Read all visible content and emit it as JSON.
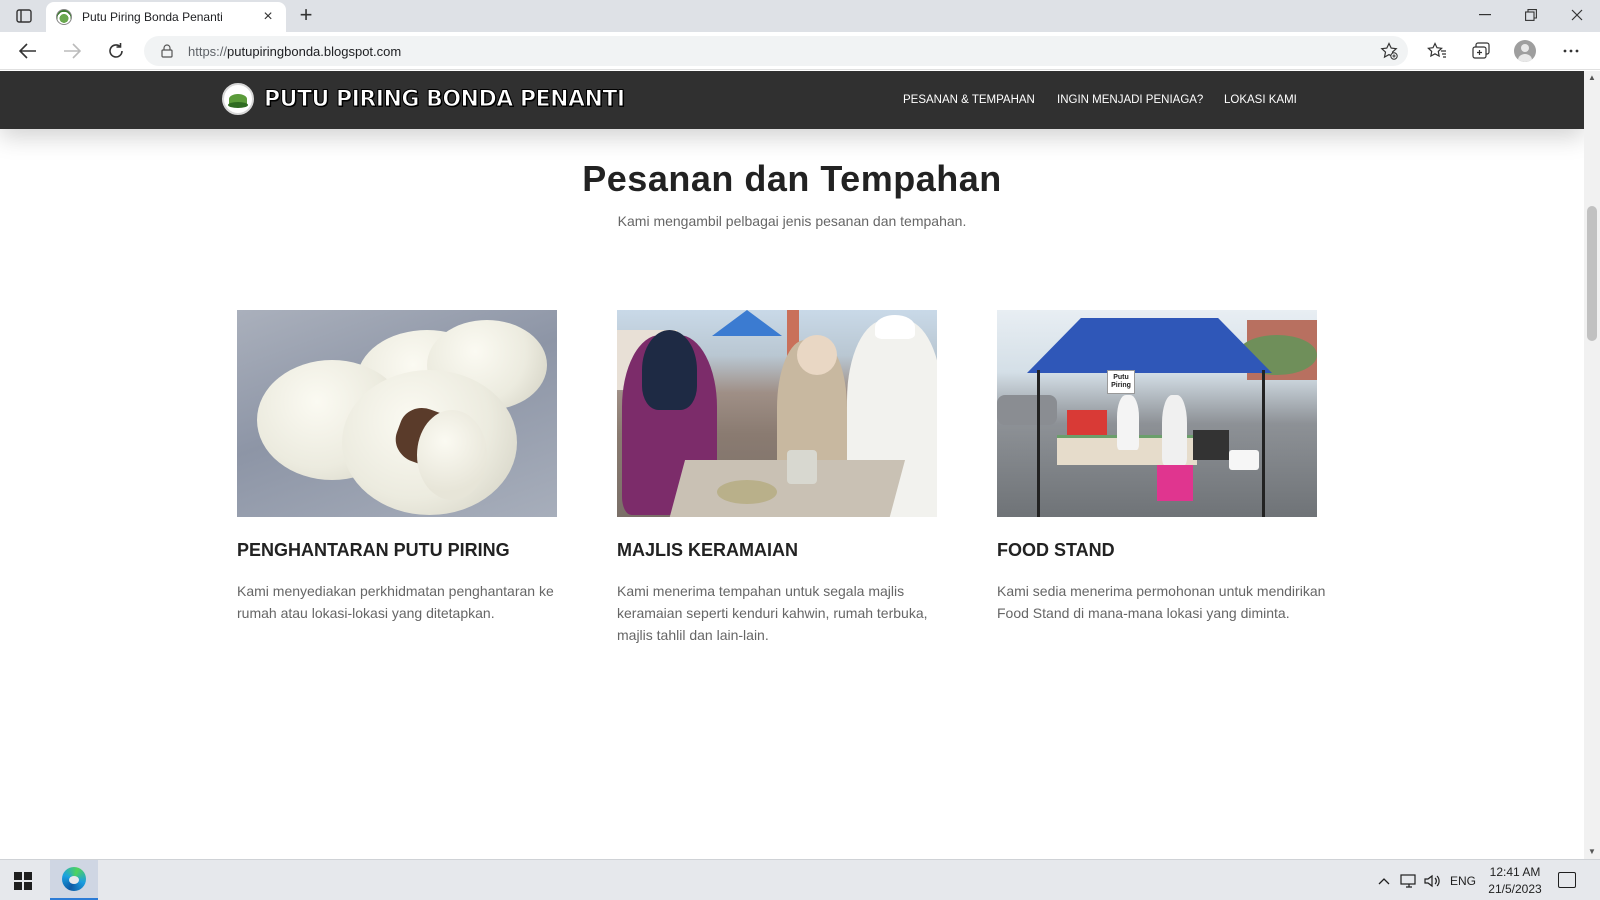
{
  "browser": {
    "tab_title": "Putu Piring Bonda Penanti",
    "url_protocol": "https://",
    "url_host": "putupiringbonda.blogspot.com"
  },
  "site": {
    "brand": "PUTU PIRING BONDA PENANTI",
    "menu": [
      {
        "label": "PESANAN & TEMPAHAN"
      },
      {
        "label": "INGIN MENJADI PENIAGA?"
      },
      {
        "label": "LOKASI KAMI"
      }
    ],
    "section_title": "Pesanan dan Tempahan",
    "section_subtitle": "Kami mengambil pelbagai jenis pesanan dan tempahan.",
    "cards": [
      {
        "title": "PENGHANTARAN PUTU PIRING",
        "text": "Kami menyediakan perkhidmatan penghantaran ke rumah atau lokasi-lokasi yang ditetapkan."
      },
      {
        "title": "MAJLIS KERAMAIAN",
        "text": "Kami menerima tempahan untuk segala majlis keramaian seperti kenduri kahwin, rumah terbuka, majlis tahlil dan lain-lain."
      },
      {
        "title": "FOOD STAND",
        "text": "Kami sedia menerima permohonan untuk mendirikan Food Stand di mana-mana lokasi yang diminta.",
        "image_sign": "Putu Piring"
      }
    ]
  },
  "taskbar": {
    "lang": "ENG",
    "time": "12:41 AM",
    "date": "21/5/2023"
  }
}
